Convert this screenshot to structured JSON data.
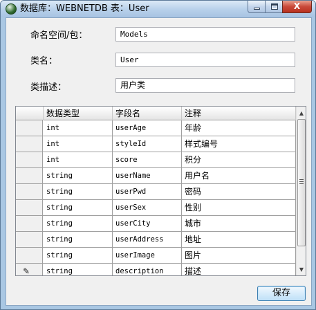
{
  "window": {
    "title": "数据库：WEBNETDB 表：User",
    "close_glyph": "X"
  },
  "form": {
    "namespace_label": "命名空间/包：",
    "namespace_value": "Models",
    "classname_label": "类名：",
    "classname_value": "User",
    "classdesc_label": "类描述：",
    "classdesc_value": "用户类"
  },
  "grid": {
    "columns": [
      "数据类型",
      "字段名",
      "注释"
    ],
    "rows": [
      {
        "type": "int",
        "field": "userAge",
        "comment": "年龄"
      },
      {
        "type": "int",
        "field": "styleId",
        "comment": "样式编号"
      },
      {
        "type": "int",
        "field": "score",
        "comment": "积分"
      },
      {
        "type": "string",
        "field": "userName",
        "comment": "用户名"
      },
      {
        "type": "string",
        "field": "userPwd",
        "comment": "密码"
      },
      {
        "type": "string",
        "field": "userSex",
        "comment": "性别"
      },
      {
        "type": "string",
        "field": "userCity",
        "comment": "城市"
      },
      {
        "type": "string",
        "field": "userAddress",
        "comment": "地址"
      },
      {
        "type": "string",
        "field": "userImage",
        "comment": "图片"
      },
      {
        "type": "string",
        "field": "description",
        "comment": "描述"
      }
    ],
    "editing_row_icon": "pencil-icon"
  },
  "buttons": {
    "save_label": "保存"
  }
}
